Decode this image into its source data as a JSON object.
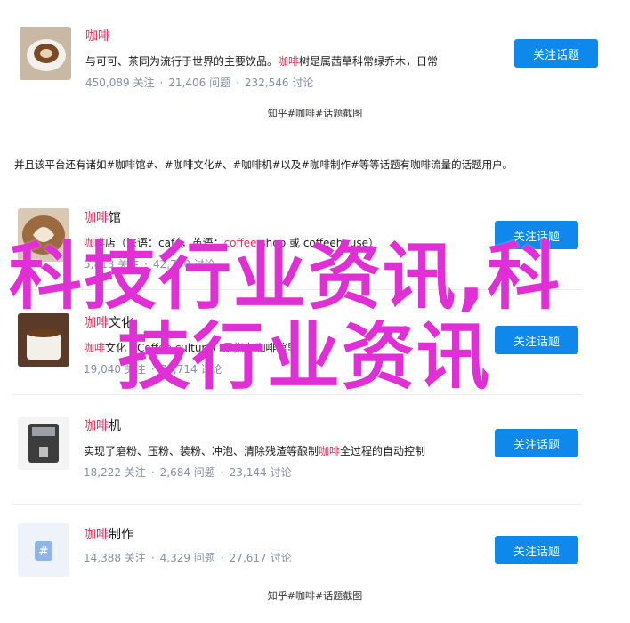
{
  "topics": [
    {
      "title_hl": "咖啡",
      "title_rest": "",
      "desc_parts": [
        {
          "t": "与可可、茶同为流行于世界的主要饮品。",
          "hl": false
        },
        {
          "t": "咖啡",
          "hl": true
        },
        {
          "t": "树是属茜草科常绿乔木，日常",
          "hl": false
        }
      ],
      "stats": [
        "450,089 关注",
        "21,406 问题",
        "232,546 讨论"
      ],
      "follow": "关注话题"
    },
    {
      "title_hl": "咖啡",
      "title_rest": "馆",
      "desc_parts": [
        {
          "t": "咖啡",
          "hl": true
        },
        {
          "t": "店（法语：café，英语：",
          "hl": false
        },
        {
          "t": "coffee",
          "hl": true
        },
        {
          "t": " shop 或 coffeehouse）",
          "hl": false
        }
      ],
      "stats": [
        "5,813 关注",
        "42,730 讨论",
        ""
      ],
      "follow": "关注话题"
    },
    {
      "title_hl": "咖啡",
      "title_rest": "文化",
      "desc_parts": [
        {
          "t": "咖啡",
          "hl": true
        },
        {
          "t": "文化（Coffee culture）是指在咖啡馆里",
          "hl": false
        }
      ],
      "stats": [
        "19,040 关注",
        "",
        "73,714 讨论"
      ],
      "follow": "关注话题"
    },
    {
      "title_hl": "咖啡",
      "title_rest": "机",
      "desc_parts": [
        {
          "t": "实现了磨粉、压粉、装粉、冲泡、清除残渣等酿制",
          "hl": false
        },
        {
          "t": "咖啡",
          "hl": true
        },
        {
          "t": "全过程的自动控制",
          "hl": false
        }
      ],
      "stats": [
        "18,222 关注",
        "2,684 问题",
        "23,144 讨论"
      ],
      "follow": "关注话题"
    },
    {
      "title_hl": "咖啡",
      "title_rest": "制作",
      "desc_parts": [],
      "stats": [
        "14,388 关注",
        "4,329 问题",
        "27,617 讨论"
      ],
      "follow": "关注话题"
    }
  ],
  "caption": "知乎#咖啡#话题截图",
  "paragraph": "并且该平台还有诸如#咖啡馆#、#咖啡文化#、#咖啡机#以及#咖啡制作#等等话题有咖啡流量的话题用户。",
  "watermark": {
    "line1": "科技行业资讯,科",
    "line2": "技行业资讯"
  },
  "colors": {
    "accent": "#e0345a",
    "button": "#0f88eb",
    "muted": "#8590a6",
    "watermark": "#e02fd4"
  }
}
